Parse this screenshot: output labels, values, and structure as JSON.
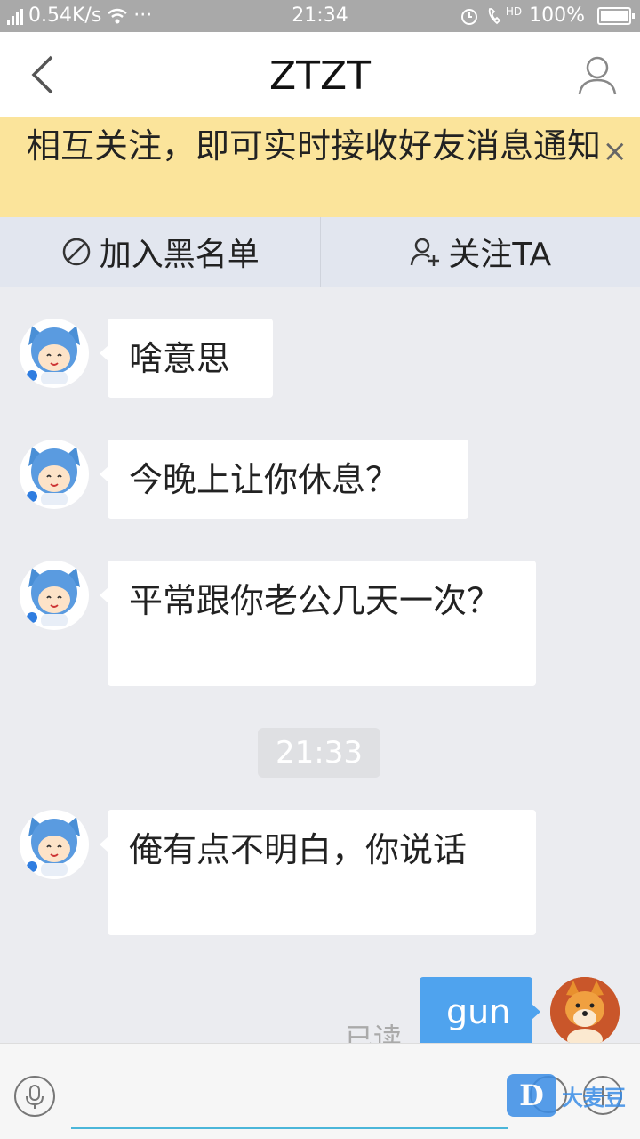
{
  "status_bar": {
    "network": "4G",
    "speed": "0.54K/s",
    "more": "···",
    "time": "21:34",
    "hd": "HD",
    "battery": "100%"
  },
  "header": {
    "title": "ZTZT"
  },
  "notice": {
    "text": "相互关注，即可实时接收好友消息通知",
    "close": "×"
  },
  "actions": {
    "blacklist": "加入黑名单",
    "follow": "关注TA"
  },
  "messages": [
    {
      "sender": "other",
      "text": "啥意思"
    },
    {
      "sender": "other",
      "text": "今晚上让你休息？"
    },
    {
      "sender": "other",
      "text": "平常跟你老公几天一次？"
    },
    {
      "sender": "other",
      "text": "俺有点不明白，你说话"
    },
    {
      "sender": "me",
      "text": "gun",
      "status": "已读"
    }
  ],
  "timestamp": "21:33",
  "watermark": {
    "logo": "D",
    "text": "大麦豆"
  },
  "colors": {
    "notice_bg": "#fbe49b",
    "my_bubble": "#4fa3ee",
    "page_bg": "#ebecf0"
  }
}
